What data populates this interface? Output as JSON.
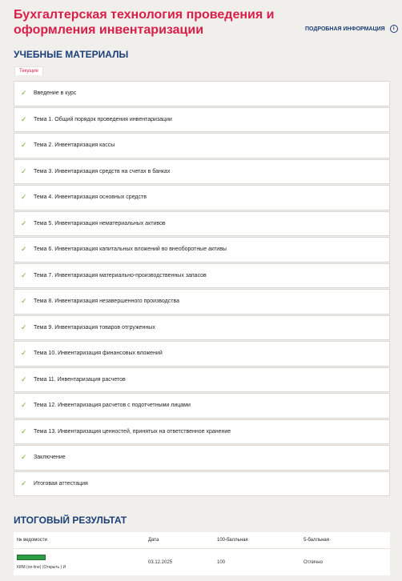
{
  "header": {
    "title": "Бухгалтерская технология проведения и оформления инвентаризации",
    "more_info": "ПОДРОБНАЯ ИНФОРМАЦИЯ",
    "more_info_icon": "info-icon"
  },
  "materials": {
    "heading": "УЧЕБНЫЕ МАТЕРИАЛЫ",
    "tab": "Текущие",
    "check_icon": "check-icon",
    "items": [
      {
        "label": "Введение в курс"
      },
      {
        "label": "Тема 1. Общий порядок проведения инвентаризации"
      },
      {
        "label": "Тема 2. Инвентаризация кассы"
      },
      {
        "label": "Тема 3. Инвентаризация средств на счетах в банках"
      },
      {
        "label": "Тема 4. Инвентаризация основных средств"
      },
      {
        "label": "Тема 5. Инвентаризация нематериальных активов"
      },
      {
        "label": "Тема 6. Инвентаризация капитальных вложений во внеоборотные активы"
      },
      {
        "label": "Тема 7. Инвентаризация материально-производственных запасов"
      },
      {
        "label": "Тема 8. Инвентаризация незавершенного производства"
      },
      {
        "label": "Тема 9. Инвентаризация товаров отгруженных"
      },
      {
        "label": "Тема 10. Инвентаризация финансовых вложений"
      },
      {
        "label": "Тема 11. Инвентаризация расчетов"
      },
      {
        "label": "Тема 12. Инвентаризация расчетов с подотчетными лицами"
      },
      {
        "label": "Тема 13. Инвентаризация ценностей, принятых на ответственное хранение"
      },
      {
        "label": "Заключение"
      },
      {
        "label": "Итоговая аттестация"
      }
    ]
  },
  "result": {
    "heading": "ИТОГОВЫЙ РЕЗУЛЬТАТ",
    "columns": [
      "№ ведомости",
      "Дата",
      "100-балльная",
      "5-балльная"
    ],
    "rows": [
      {
        "sheet": "КИМ (on-line) (Открыть ) И",
        "date": "03.12.2025",
        "score100": "100",
        "score5": "Отлично"
      }
    ]
  }
}
